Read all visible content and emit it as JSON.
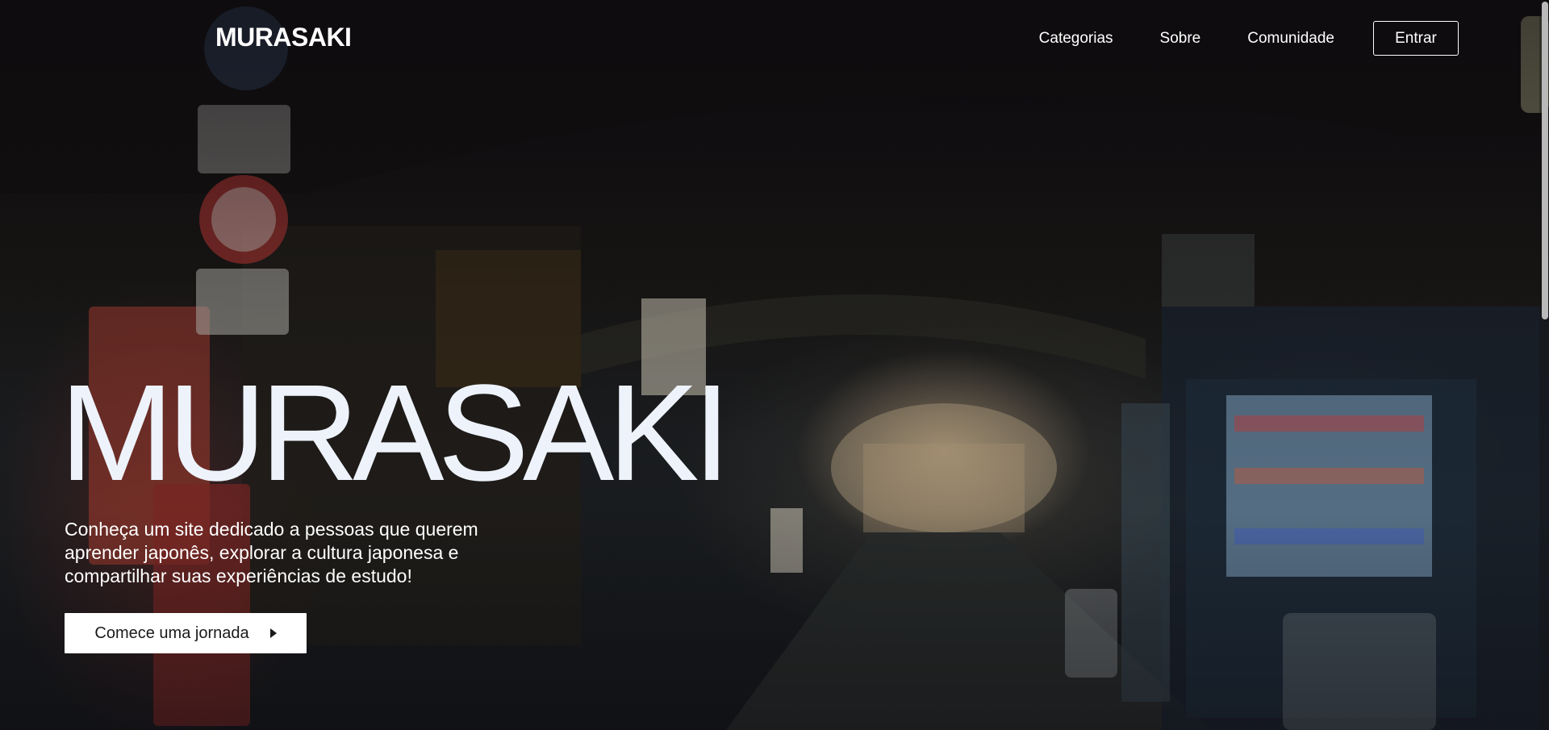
{
  "header": {
    "logo": "MURASAKI",
    "nav": [
      "Categorias",
      "Sobre",
      "Comunidade"
    ],
    "login_label": "Entrar"
  },
  "hero": {
    "title": "MURASAKI",
    "description": "Conheça um site dedicado a pessoas que querem aprender japonês, explorar a cultura japonesa e compartilhar suas experiências de estudo!",
    "cta_label": "Comece uma jornada",
    "cta_icon": "caret-right-icon",
    "background": "night-street-photo"
  },
  "colors": {
    "title": "#eef3fb",
    "text": "#ffffff",
    "cta_background": "#ffffff",
    "cta_text": "#1a1a1a"
  }
}
